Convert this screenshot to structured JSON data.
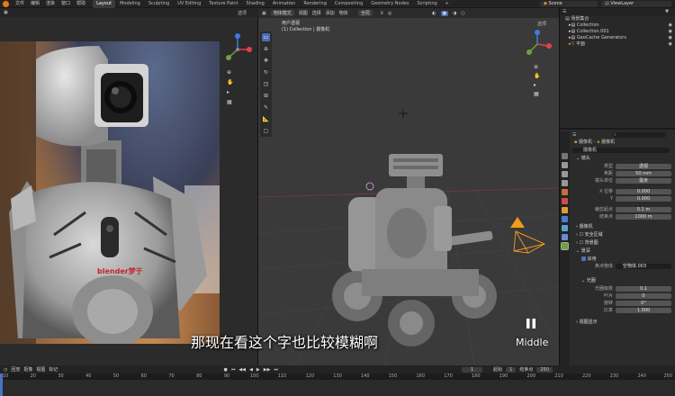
{
  "menu": [
    "文件",
    "编辑",
    "渲染",
    "窗口",
    "帮助"
  ],
  "workspaces": [
    "Layout",
    "Modeling",
    "Sculpting",
    "UV Editing",
    "Texture Paint",
    "Shading",
    "Animation",
    "Rendering",
    "Compositing",
    "Geometry Nodes",
    "Scripting"
  ],
  "active_workspace": "Layout",
  "top_right": {
    "scene_label": "Scene",
    "view_layer_label": "ViewLayer"
  },
  "left_header": {
    "overlays_label": "选项"
  },
  "viewport": {
    "header": [
      "物体模式",
      "视图",
      "选择",
      "添加",
      "物体",
      "全局"
    ],
    "view_name": "用户透视",
    "collection_label": "(1) Collection | 摄像机",
    "options_label": "选项",
    "badge_text": "Middle"
  },
  "outliner": {
    "title": "场景集合",
    "rows": [
      "Collection",
      "Collection.001",
      "GeoCache Generators",
      "平面"
    ]
  },
  "properties": {
    "search_value": "",
    "path": [
      "摄像机",
      "摄像机"
    ],
    "object_name": "摄像机",
    "sections": {
      "lens": "镜头",
      "camera": "摄像机",
      "dof": "景深",
      "safe_areas": "安全区域",
      "background": "背景图",
      "viewport_display": "视图显示",
      "custom_props": "自定义属性"
    },
    "lens_rows": [
      {
        "label": "类型",
        "value": "透视"
      },
      {
        "label": "焦距",
        "value": "50 mm"
      },
      {
        "label": "镜头单位",
        "value": "毫米"
      },
      {
        "label": "X 位移",
        "value": "0.000"
      },
      {
        "label": "Y",
        "value": "0.000"
      },
      {
        "label": "裁剪起点",
        "value": "0.1 m"
      },
      {
        "label": "结束点",
        "value": "1000 m"
      }
    ],
    "dof_enabled_label": "启用",
    "dof_object_label": "焦点物体",
    "dof_object_value": "空物体.003",
    "aperture_label": "光圈",
    "aperture_rows": [
      {
        "label": "光圈级数",
        "value": "0.1"
      },
      {
        "label": "叶片",
        "value": "0"
      },
      {
        "label": "旋转",
        "value": "0°"
      },
      {
        "label": "比率",
        "value": "1.000"
      }
    ]
  },
  "timeline": {
    "menu": [
      "回放",
      "抠像",
      "视图",
      "标记"
    ],
    "current_frame": "1",
    "start_label": "起始",
    "start_value": "1",
    "end_label": "结束点",
    "end_value": "250",
    "ticks": [
      "10",
      "20",
      "30",
      "40",
      "50",
      "60",
      "70",
      "80",
      "90",
      "100",
      "110",
      "120",
      "130",
      "140",
      "150",
      "160",
      "170",
      "180",
      "190",
      "200",
      "210",
      "220",
      "230",
      "240",
      "250"
    ]
  },
  "subtitle": "那现在看这个字也比较模糊啊",
  "render_brand": "blender梦于",
  "colors": {
    "accent": "#4a72c4",
    "camera_orange": "#f39a1e",
    "axis_red": "#e2404a",
    "axis_green": "#6ba33a",
    "axis_blue": "#3d7bde"
  }
}
